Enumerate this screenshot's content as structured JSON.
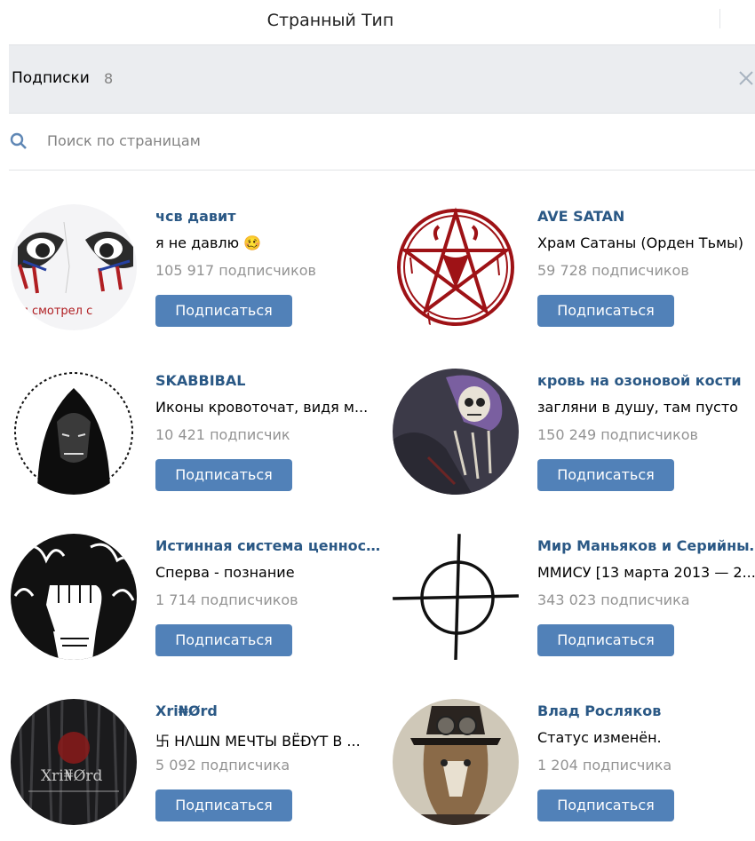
{
  "header": {
    "title": "Странный Тип"
  },
  "subscriptions": {
    "label": "Подписки",
    "count": "8",
    "close_icon": "close-icon"
  },
  "search": {
    "placeholder": "Поиск по страницам",
    "icon": "search-icon"
  },
  "button_label": "Подписаться",
  "communities": [
    {
      "name": "чсв давит",
      "status": "я не давлю",
      "emoji": "🥴",
      "subscribers": "105 917 подписчиков",
      "avatar_caption": "я смотрел с",
      "avatar": "eyes-drawing"
    },
    {
      "name": "AVE SATAN",
      "status": "Храм Сатаны (Орден Тьмы)",
      "subscribers": "59 728 подписчиков",
      "avatar": "pentagram-goat"
    },
    {
      "name": "SKABBIBAL",
      "status": "Иконы кровоточат, видя м...",
      "subscribers": "10 421 подписчик",
      "avatar": "hooded-figure"
    },
    {
      "name": "кровь на озоновой кости",
      "status": "загляни в душу, там пусто",
      "subscribers": "150 249 подписчиков",
      "avatar": "skeleton-art"
    },
    {
      "name": "Истинная система ценност...",
      "status": "Сперва - познание",
      "subscribers": "1 714 подписчиков",
      "avatar": "fist-flames"
    },
    {
      "name": "Мир Маньяков и Серийны...",
      "status": "ММИСУ [13 марта 2013 — 2...",
      "subscribers": "343 023 подписчика",
      "avatar": "zodiac-crosshair"
    },
    {
      "name": "Xri₦Ørd",
      "status": "卐 HΛШN МЕЧТЫ BЁÐYТ В ...",
      "subscribers": "5 092 подписчика",
      "avatar_caption": "Xri₦Ørd",
      "avatar": "dark-forest"
    },
    {
      "name": "Влад Росляков",
      "status": "Статус изменён.",
      "subscribers": "1 204 подписчика",
      "avatar": "wolf-top-hat"
    }
  ]
}
